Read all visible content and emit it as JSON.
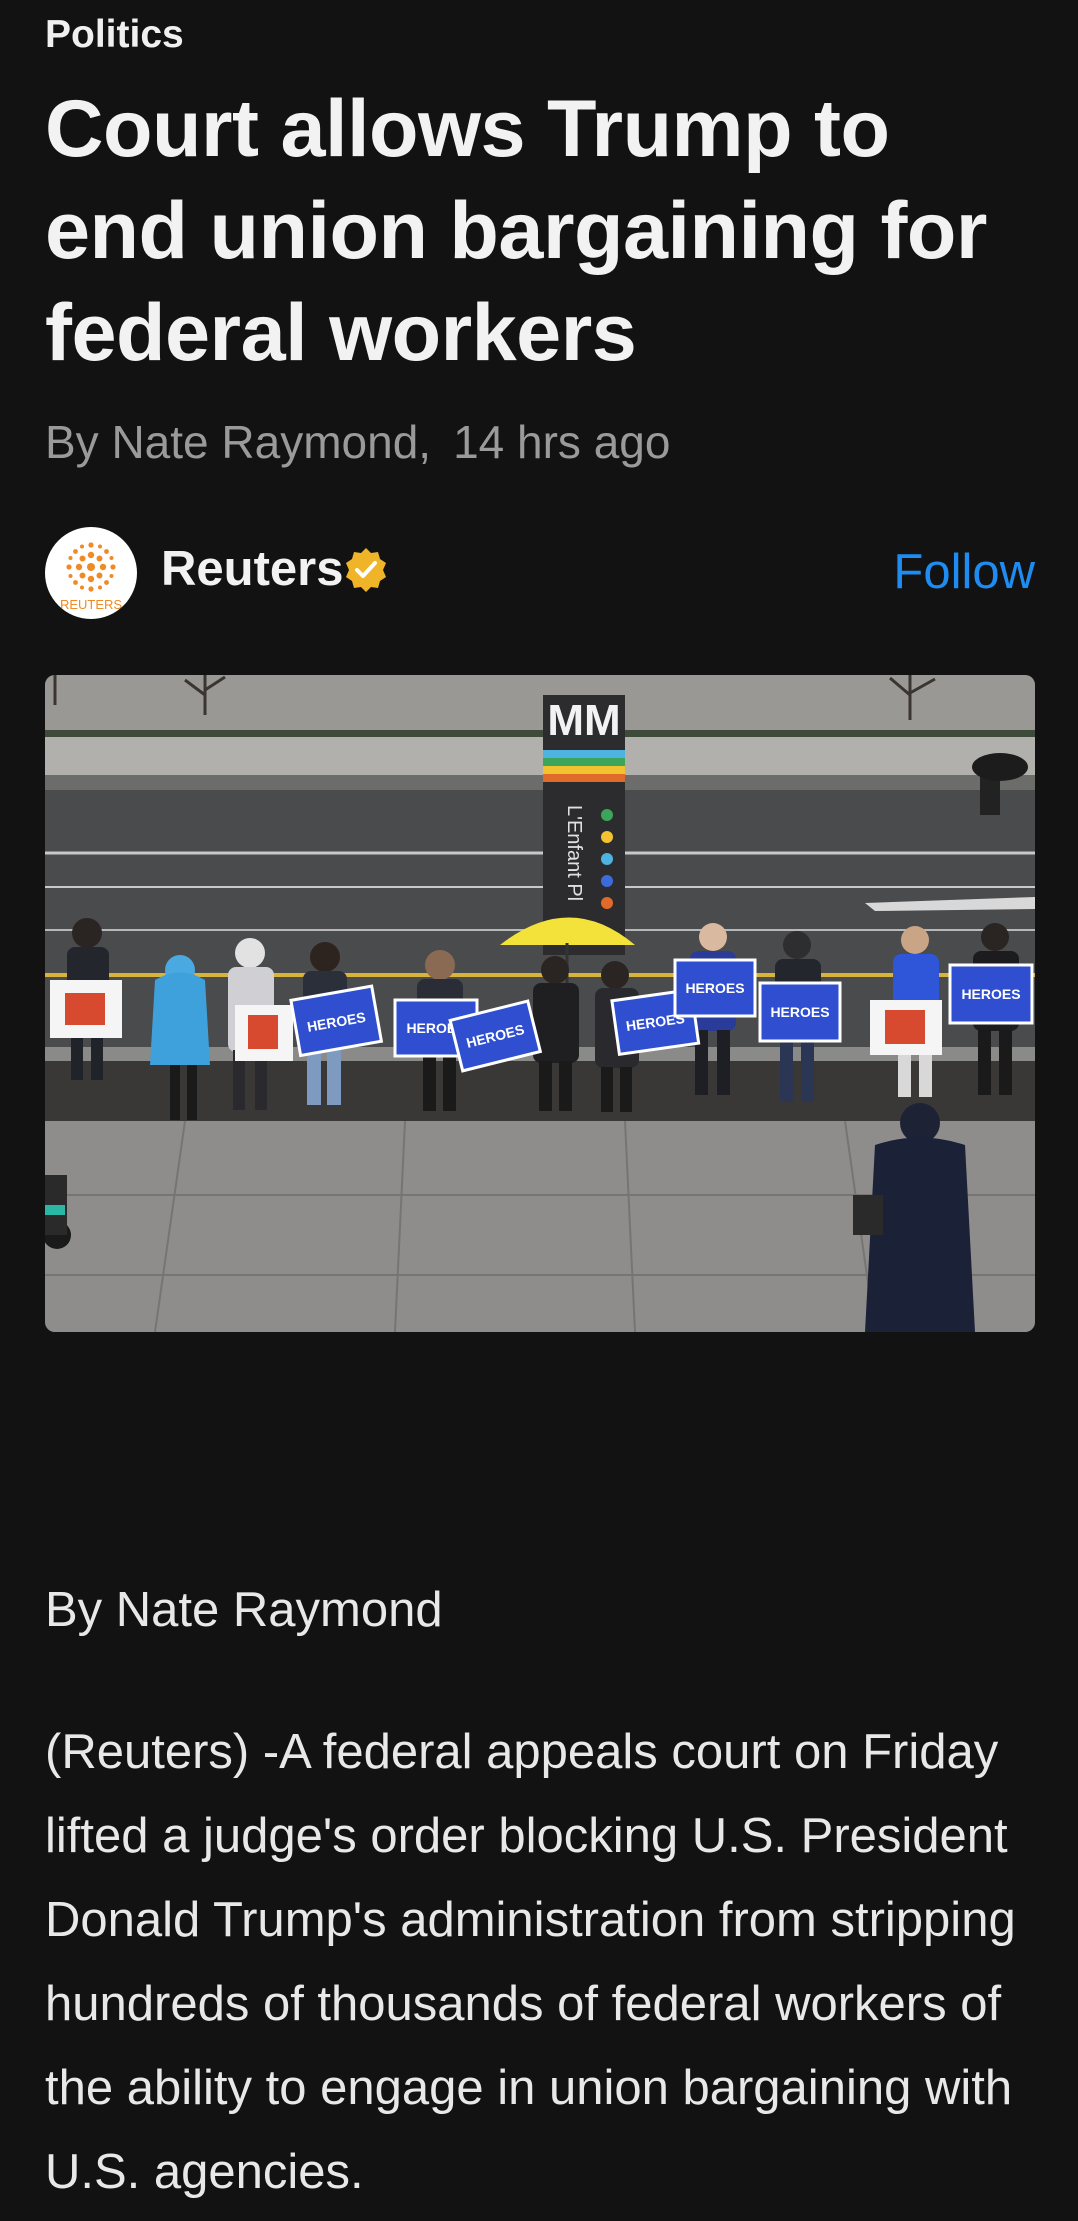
{
  "article": {
    "category": "Politics",
    "headline": "Court allows Trump to end union bargaining for federal workers",
    "author_line": "By Nate Raymond,",
    "time_ago": "14 hrs ago",
    "byline_body": "By Nate Raymond",
    "paragraph": "(Reuters) -A federal appeals court on Friday lifted a judge's order blocking U.S. President Donald Trump's administration from stripping hundreds of thousands of federal workers of the ability to engage in union bargaining with U.S. agencies."
  },
  "source": {
    "name": "Reuters",
    "logo_text": "REUTERS",
    "follow_label": "Follow",
    "verified_color": "#f0b429",
    "logo_color": "#f08a24"
  },
  "hero_image": {
    "station_sign": "MM",
    "street_sign": "L'Enfant Pl",
    "sign_text": "HEROES",
    "accent_sign_color": "#2f4fd0",
    "umbrella_color": "#f2e23a"
  },
  "theme": {
    "background": "#121212",
    "link_color": "#1e8cf0"
  }
}
